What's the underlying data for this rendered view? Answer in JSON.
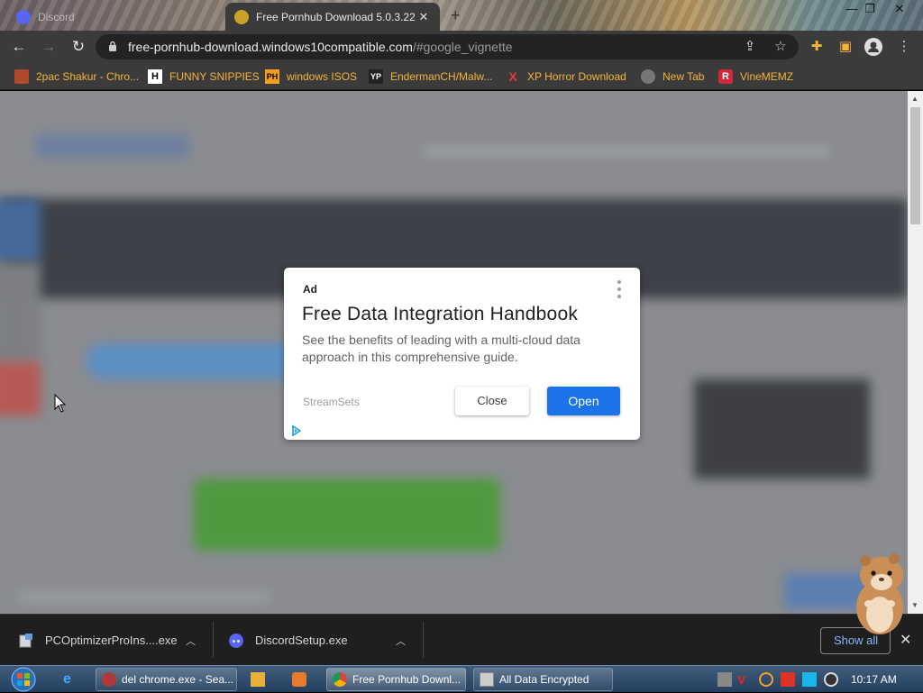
{
  "browser": {
    "tabs": [
      {
        "title": "Discord",
        "active": false
      },
      {
        "title": "Free Pornhub Download 5.0.3.22",
        "active": true
      }
    ],
    "url": {
      "host": "free-pornhub-download.windows10compatible.com",
      "path": "/#google_vignette"
    },
    "bookmarks": [
      {
        "label": "2pac Shakur - Chro...",
        "icon": "fist-icon"
      },
      {
        "label": "FUNNY SNIPPIES",
        "icon": "H"
      },
      {
        "label": "windows ISOS",
        "icon": "PH"
      },
      {
        "label": "EndermanCH/Malw...",
        "icon": "YP"
      },
      {
        "label": "XP Horror Download",
        "icon": "X"
      },
      {
        "label": "New Tab",
        "icon": "globe-icon"
      },
      {
        "label": "VineMEMZ",
        "icon": "R"
      }
    ]
  },
  "ad": {
    "label": "Ad",
    "headline": "Free Data Integration Handbook",
    "body": "See the benefits of leading with a multi-cloud data approach in this comprehensive guide.",
    "advertiser": "StreamSets",
    "close_label": "Close",
    "open_label": "Open"
  },
  "downloads": {
    "items": [
      {
        "filename": "PCOptimizerProIns....exe"
      },
      {
        "filename": "DiscordSetup.exe"
      }
    ],
    "show_all_label": "Show all"
  },
  "taskbar": {
    "windows": [
      {
        "label": "del chrome.exe - Sea...",
        "active": false
      },
      {
        "label": "Free Pornhub Downl...",
        "active": true
      },
      {
        "label": "All Data Encrypted",
        "active": false
      }
    ],
    "clock": "10:17 AM"
  },
  "colors": {
    "accent_blue": "#1a73e8",
    "bookmark_text": "#f2b33c",
    "chrome_dark": "#3b3b3b"
  }
}
